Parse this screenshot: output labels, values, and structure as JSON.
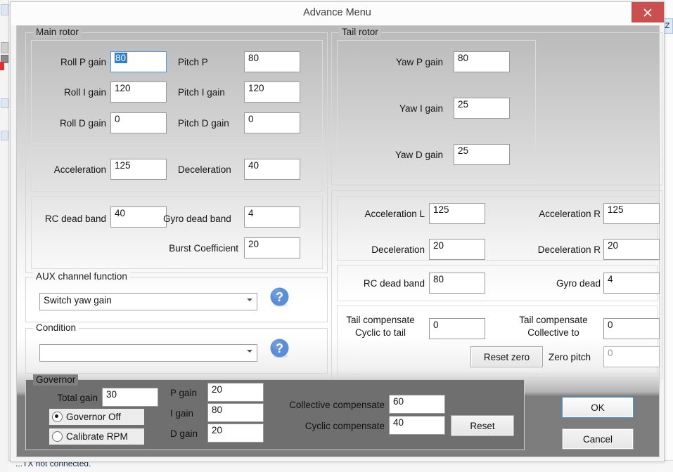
{
  "background_app": {
    "status_text": "...TX not connected.",
    "right_tab_label": "Z"
  },
  "dialog": {
    "title": "Advance Menu",
    "close_icon": "close-icon"
  },
  "main_rotor": {
    "legend": "Main rotor",
    "pid": {
      "roll_p": {
        "label": "Roll P gain",
        "value": "80",
        "focused": true,
        "selected": true
      },
      "pitch_p": {
        "label": "Pitch P",
        "value": "80"
      },
      "roll_i": {
        "label": "Roll I gain",
        "value": "120"
      },
      "pitch_i": {
        "label": "Pitch I gain",
        "value": "120"
      },
      "roll_d": {
        "label": "Roll D gain",
        "value": "0"
      },
      "pitch_d": {
        "label": "Pitch D gain",
        "value": "0"
      }
    },
    "accel": {
      "acceleration": {
        "label": "Acceleration",
        "value": "125"
      },
      "deceleration": {
        "label": "Deceleration",
        "value": "40"
      }
    },
    "deadband": {
      "rc_dead_band": {
        "label": "RC dead band",
        "value": "40"
      },
      "gyro_dead_band": {
        "label": "Gyro dead band",
        "value": "4"
      },
      "burst_coefficient": {
        "label": "Burst Coefficient",
        "value": "20"
      }
    }
  },
  "aux_channel": {
    "legend": "AUX channel function",
    "selected": "Switch yaw gain",
    "help_icon": "help-question-icon"
  },
  "condition": {
    "legend": "Condition",
    "selected": "",
    "help_icon": "help-question-icon"
  },
  "tail_rotor": {
    "legend": "Tail rotor",
    "pid": {
      "yaw_p": {
        "label": "Yaw P gain",
        "value": "80"
      },
      "yaw_i": {
        "label": "Yaw I gain",
        "value": "25"
      },
      "yaw_d": {
        "label": "Yaw D gain",
        "value": "25"
      }
    },
    "accel": {
      "acceleration_l": {
        "label": "Acceleration L",
        "value": "125"
      },
      "acceleration_r": {
        "label": "Acceleration R",
        "value": "125"
      },
      "deceleration": {
        "label": "Deceleration",
        "value": "20"
      },
      "deceleration_r": {
        "label": "Deceleration R",
        "value": "20"
      }
    },
    "deadband": {
      "rc_dead_band": {
        "label": "RC dead band",
        "value": "80"
      },
      "gyro_dead": {
        "label": "Gyro dead",
        "value": "4"
      }
    },
    "compensate": {
      "cyclic_to_tail": {
        "label_line1": "Tail compensate",
        "label_line2": "Cyclic to tail",
        "value": "0"
      },
      "collective_to": {
        "label_line1": "Tail compensate",
        "label_line2": "Collective to",
        "value": "0"
      },
      "reset_zero_button": "Reset zero",
      "zero_pitch": {
        "label": "Zero pitch",
        "value": "0",
        "disabled": true
      }
    }
  },
  "governor": {
    "legend": "Governor",
    "total_gain": {
      "label": "Total gain",
      "value": "30"
    },
    "radios": [
      {
        "label": "Governor Off",
        "checked": true
      },
      {
        "label": "Calibrate RPM",
        "checked": false
      }
    ],
    "p_gain": {
      "label": "P gain",
      "value": "20"
    },
    "i_gain": {
      "label": "I gain",
      "value": "80"
    },
    "d_gain": {
      "label": "D gain",
      "value": "20"
    },
    "collective_compensate": {
      "label": "Collective compensate",
      "value": "60"
    },
    "cyclic_compensate": {
      "label": "Cyclic compensate",
      "value": "40"
    },
    "reset_button": "Reset"
  },
  "actions": {
    "ok": "OK",
    "cancel": "Cancel"
  },
  "colors": {
    "close_red": "#c9504f",
    "focus_blue": "#4a9fe0",
    "selection_blue": "#2a7fd4",
    "help_blue": "#5b8ed6",
    "governor_panel": "#6f6f6f"
  }
}
